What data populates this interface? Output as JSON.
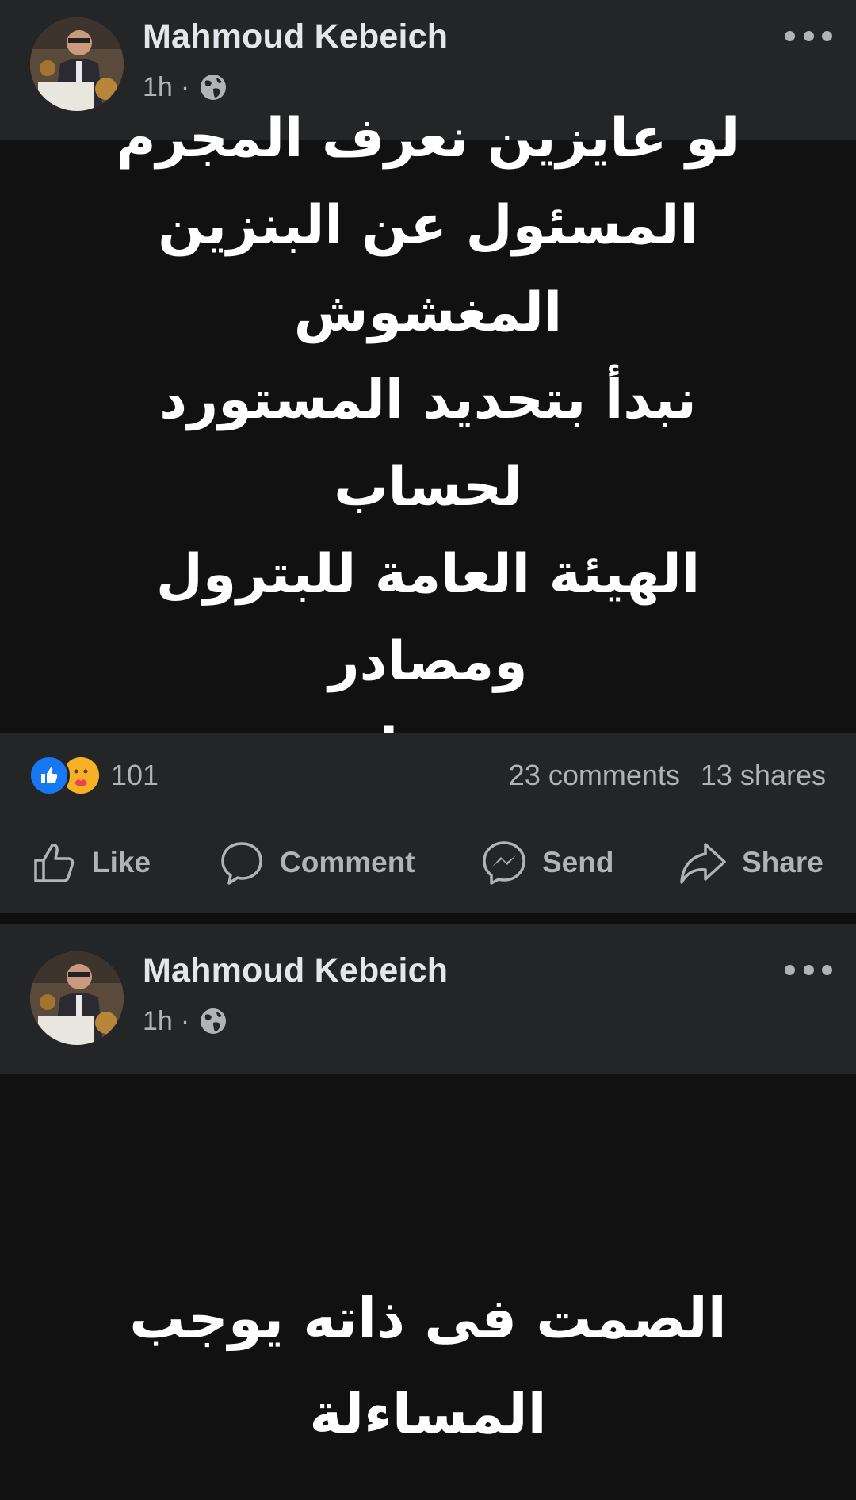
{
  "posts": [
    {
      "author": "Mahmoud Kebeich",
      "time": "1h",
      "separator": "·",
      "text": "لو عايزين نعرف المجرم\nالمسئول عن البنزين المغشوش\nنبدأ بتحديد المستورد لحساب\nالهيئة العامة للبترول ومصادر\nصفقاته",
      "reaction_count": "101",
      "comments": "23 comments",
      "shares": "13 shares",
      "actions": {
        "like": "Like",
        "comment": "Comment",
        "send": "Send",
        "share": "Share"
      }
    },
    {
      "author": "Mahmoud Kebeich",
      "time": "1h",
      "separator": "·",
      "text": "الصمت فى ذاته يوجب\nالمساءلة"
    }
  ],
  "colors": {
    "background": "#18191a",
    "card": "#242526",
    "post_body": "#111112",
    "text_primary": "#e4e6eb",
    "text_secondary": "#b0b3b8",
    "like_blue": "#1877f2",
    "care_yellow": "#f7b125"
  },
  "icons": [
    "avatar",
    "globe-icon",
    "more-icon",
    "like-reaction-icon",
    "care-reaction-icon",
    "like-icon",
    "comment-icon",
    "messenger-icon",
    "share-icon"
  ]
}
